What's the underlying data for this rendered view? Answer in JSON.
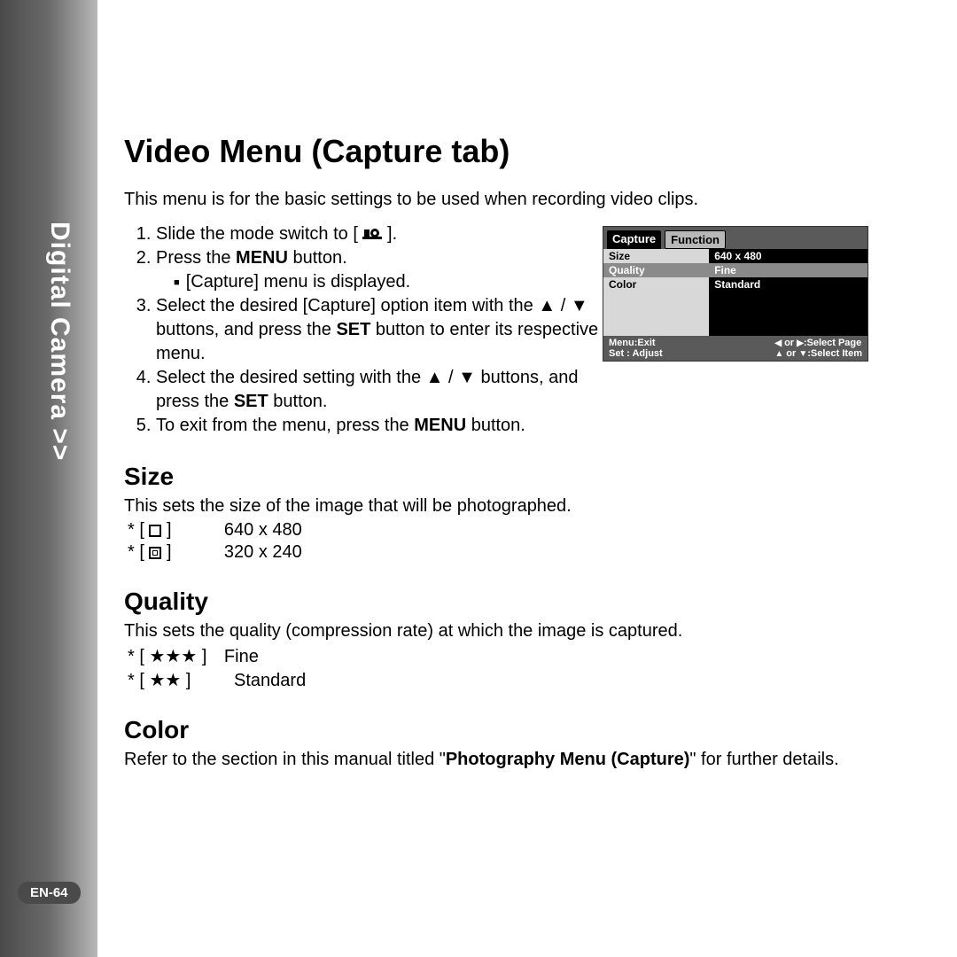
{
  "sidebar": {
    "label": "Digital Camera >>"
  },
  "page_number": "EN-64",
  "title": "Video Menu (Capture tab)",
  "intro": "This menu is for the basic settings to be used when recording video clips.",
  "steps": {
    "s1_a": "Slide the mode switch to [ ",
    "s1_b": " ].",
    "s2_a": "Press the ",
    "s2_menu": "MENU",
    "s2_b": " button.",
    "s2_sub": "[Capture] menu is displayed.",
    "s3_a": "Select the desired [Capture] option item with the ",
    "s3_b": " buttons, and press the ",
    "s3_set": "SET",
    "s3_c": " button to enter its respective menu.",
    "s4_a": "Select the desired setting with the ",
    "s4_b": " buttons, and press the ",
    "s4_set": "SET",
    "s4_c": " button.",
    "s5_a": "To exit from the menu, press the ",
    "s5_menu": "MENU",
    "s5_b": " button."
  },
  "size": {
    "heading": "Size",
    "desc": "This sets the size of the image that will be photographed.",
    "opt1": "640 x 480",
    "opt2": "320 x 240"
  },
  "quality": {
    "heading": "Quality",
    "desc": "This sets the quality (compression rate) at which the image is captured.",
    "opt1_label": "Fine",
    "opt2_label": "Standard"
  },
  "color": {
    "heading": "Color",
    "desc_a": "Refer to the section in this manual titled \"",
    "desc_bold": "Photography Menu (Capture)",
    "desc_b": "\" for further details."
  },
  "menu_fig": {
    "tab_capture": "Capture",
    "tab_function": "Function",
    "row_size": "Size",
    "row_quality": "Quality",
    "row_color": "Color",
    "val_size": "640 x 480",
    "val_quality": "Fine",
    "val_color": "Standard",
    "footer_menu_exit": "Menu:Exit",
    "footer_select_page": ":Select Page",
    "footer_set_adjust": "Set : Adjust",
    "footer_select_item": ":Select Item",
    "or1": " or ",
    "or2": " or "
  }
}
